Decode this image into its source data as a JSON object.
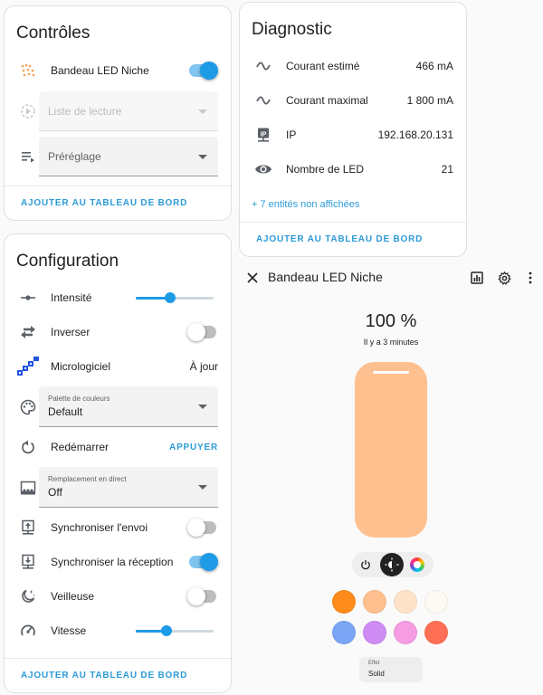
{
  "controls": {
    "title": "Contrôles",
    "led_strip": {
      "label": "Bandeau LED Niche",
      "on": true
    },
    "playlist": {
      "placeholder": "Liste de lecture"
    },
    "preset": {
      "placeholder": "Préréglage"
    },
    "footer": "AJOUTER AU TABLEAU DE BORD"
  },
  "diagnostic": {
    "title": "Diagnostic",
    "rows": [
      {
        "label": "Courant estimé",
        "value": "466 mA",
        "icon": "current-icon"
      },
      {
        "label": "Courant maximal",
        "value": "1 800 mA",
        "icon": "current-icon"
      },
      {
        "label": "IP",
        "value": "192.168.20.131",
        "icon": "ip-network-icon"
      },
      {
        "label": "Nombre de LED",
        "value": "21",
        "icon": "eye-icon"
      }
    ],
    "hidden_link": "+ 7 entités non affichées",
    "footer": "AJOUTER AU TABLEAU DE BORD"
  },
  "configuration": {
    "title": "Configuration",
    "intensity": {
      "label": "Intensité",
      "level": 0.44
    },
    "invert": {
      "label": "Inverser",
      "on": false
    },
    "firmware": {
      "label": "Micrologiciel",
      "value": "À jour"
    },
    "palette": {
      "small": "Palette de couleurs",
      "value": "Default"
    },
    "restart": {
      "label": "Redémarrer",
      "action": "APPUYER"
    },
    "live_override": {
      "small": "Remplacement en direct",
      "value": "Off"
    },
    "sync_send": {
      "label": "Synchroniser l'envoi",
      "on": false
    },
    "sync_receive": {
      "label": "Synchroniser la réception",
      "on": true
    },
    "nightlight": {
      "label": "Veilleuse",
      "on": false
    },
    "speed": {
      "label": "Vitesse",
      "level": 0.4
    },
    "footer": "AJOUTER AU TABLEAU DE BORD"
  },
  "dialog": {
    "title": "Bandeau LED Niche",
    "brightness": "100 %",
    "last_changed": "Il y a 3 minutes",
    "light_color": "#ffc08f",
    "swatches_row1": [
      "#ff8c1a",
      "#ffc08f",
      "#ffe3c9",
      "#fdfaf4"
    ],
    "swatches_row2": [
      "#7aa6f5",
      "#cf8cf5",
      "#f59ce3",
      "#ff6f55"
    ],
    "effect": {
      "small": "Effet",
      "value": "Solid"
    }
  },
  "colors": {
    "accent": "#1e9be7",
    "link": "#2d9bd7"
  }
}
